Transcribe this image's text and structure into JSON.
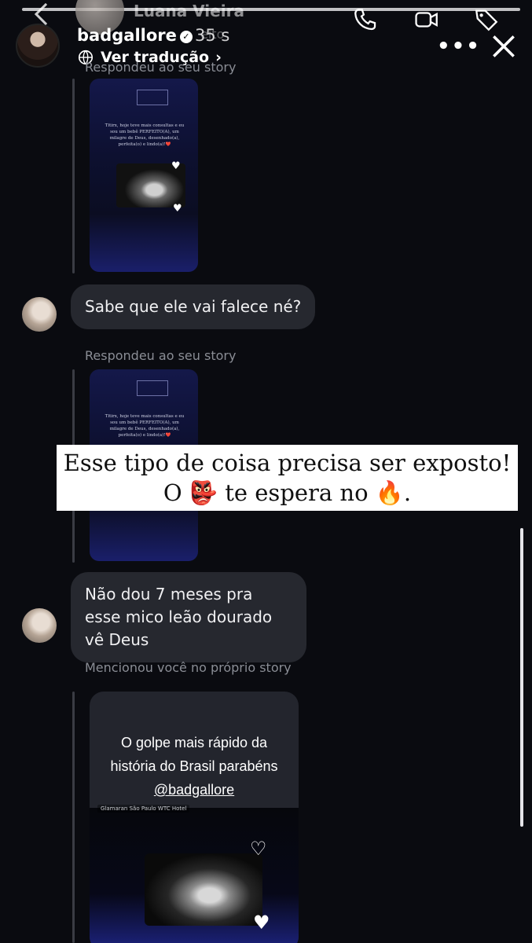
{
  "chat_header": {
    "contact_name": "Luana Vieira",
    "contact_status": "eito"
  },
  "story_header": {
    "username": "badgallore",
    "time": "35 s",
    "translate_label": "Ver tradução"
  },
  "messages": {
    "reply_label_1": "Respondeu ao seu story",
    "story_text": "Titirx, hoje teve mais consultas e eu sou um bebê PERFEITO(A), um milagre de Deus, desenhado(a), perfeita(o) e lindo(a)!❤️",
    "message_1": "Sabe que ele vai falece né?",
    "reply_label_2": "Respondeu ao seu story",
    "message_2": "Não dou 7 meses pra esse mico leão dourado vê Deus",
    "mention_label": "Mencionou você no próprio story",
    "mention_caption": "O golpe mais rápido da história do Brasil parabéns",
    "mention_handle": "@badgallore",
    "mention_location": "Glamaran São Paulo WTC Hotel"
  },
  "overlay": {
    "line1": "Esse tipo de coisa precisa ser exposto!",
    "line2_before": "O",
    "line2_emoji1": "👺",
    "line2_middle": "te espera no",
    "line2_emoji2": "🔥",
    "line2_after": "."
  },
  "icons": [
    "back-icon",
    "phone-icon",
    "video-icon",
    "tag-icon",
    "verified-icon",
    "translate-icon",
    "more-icon",
    "close-icon",
    "heart-icon"
  ]
}
